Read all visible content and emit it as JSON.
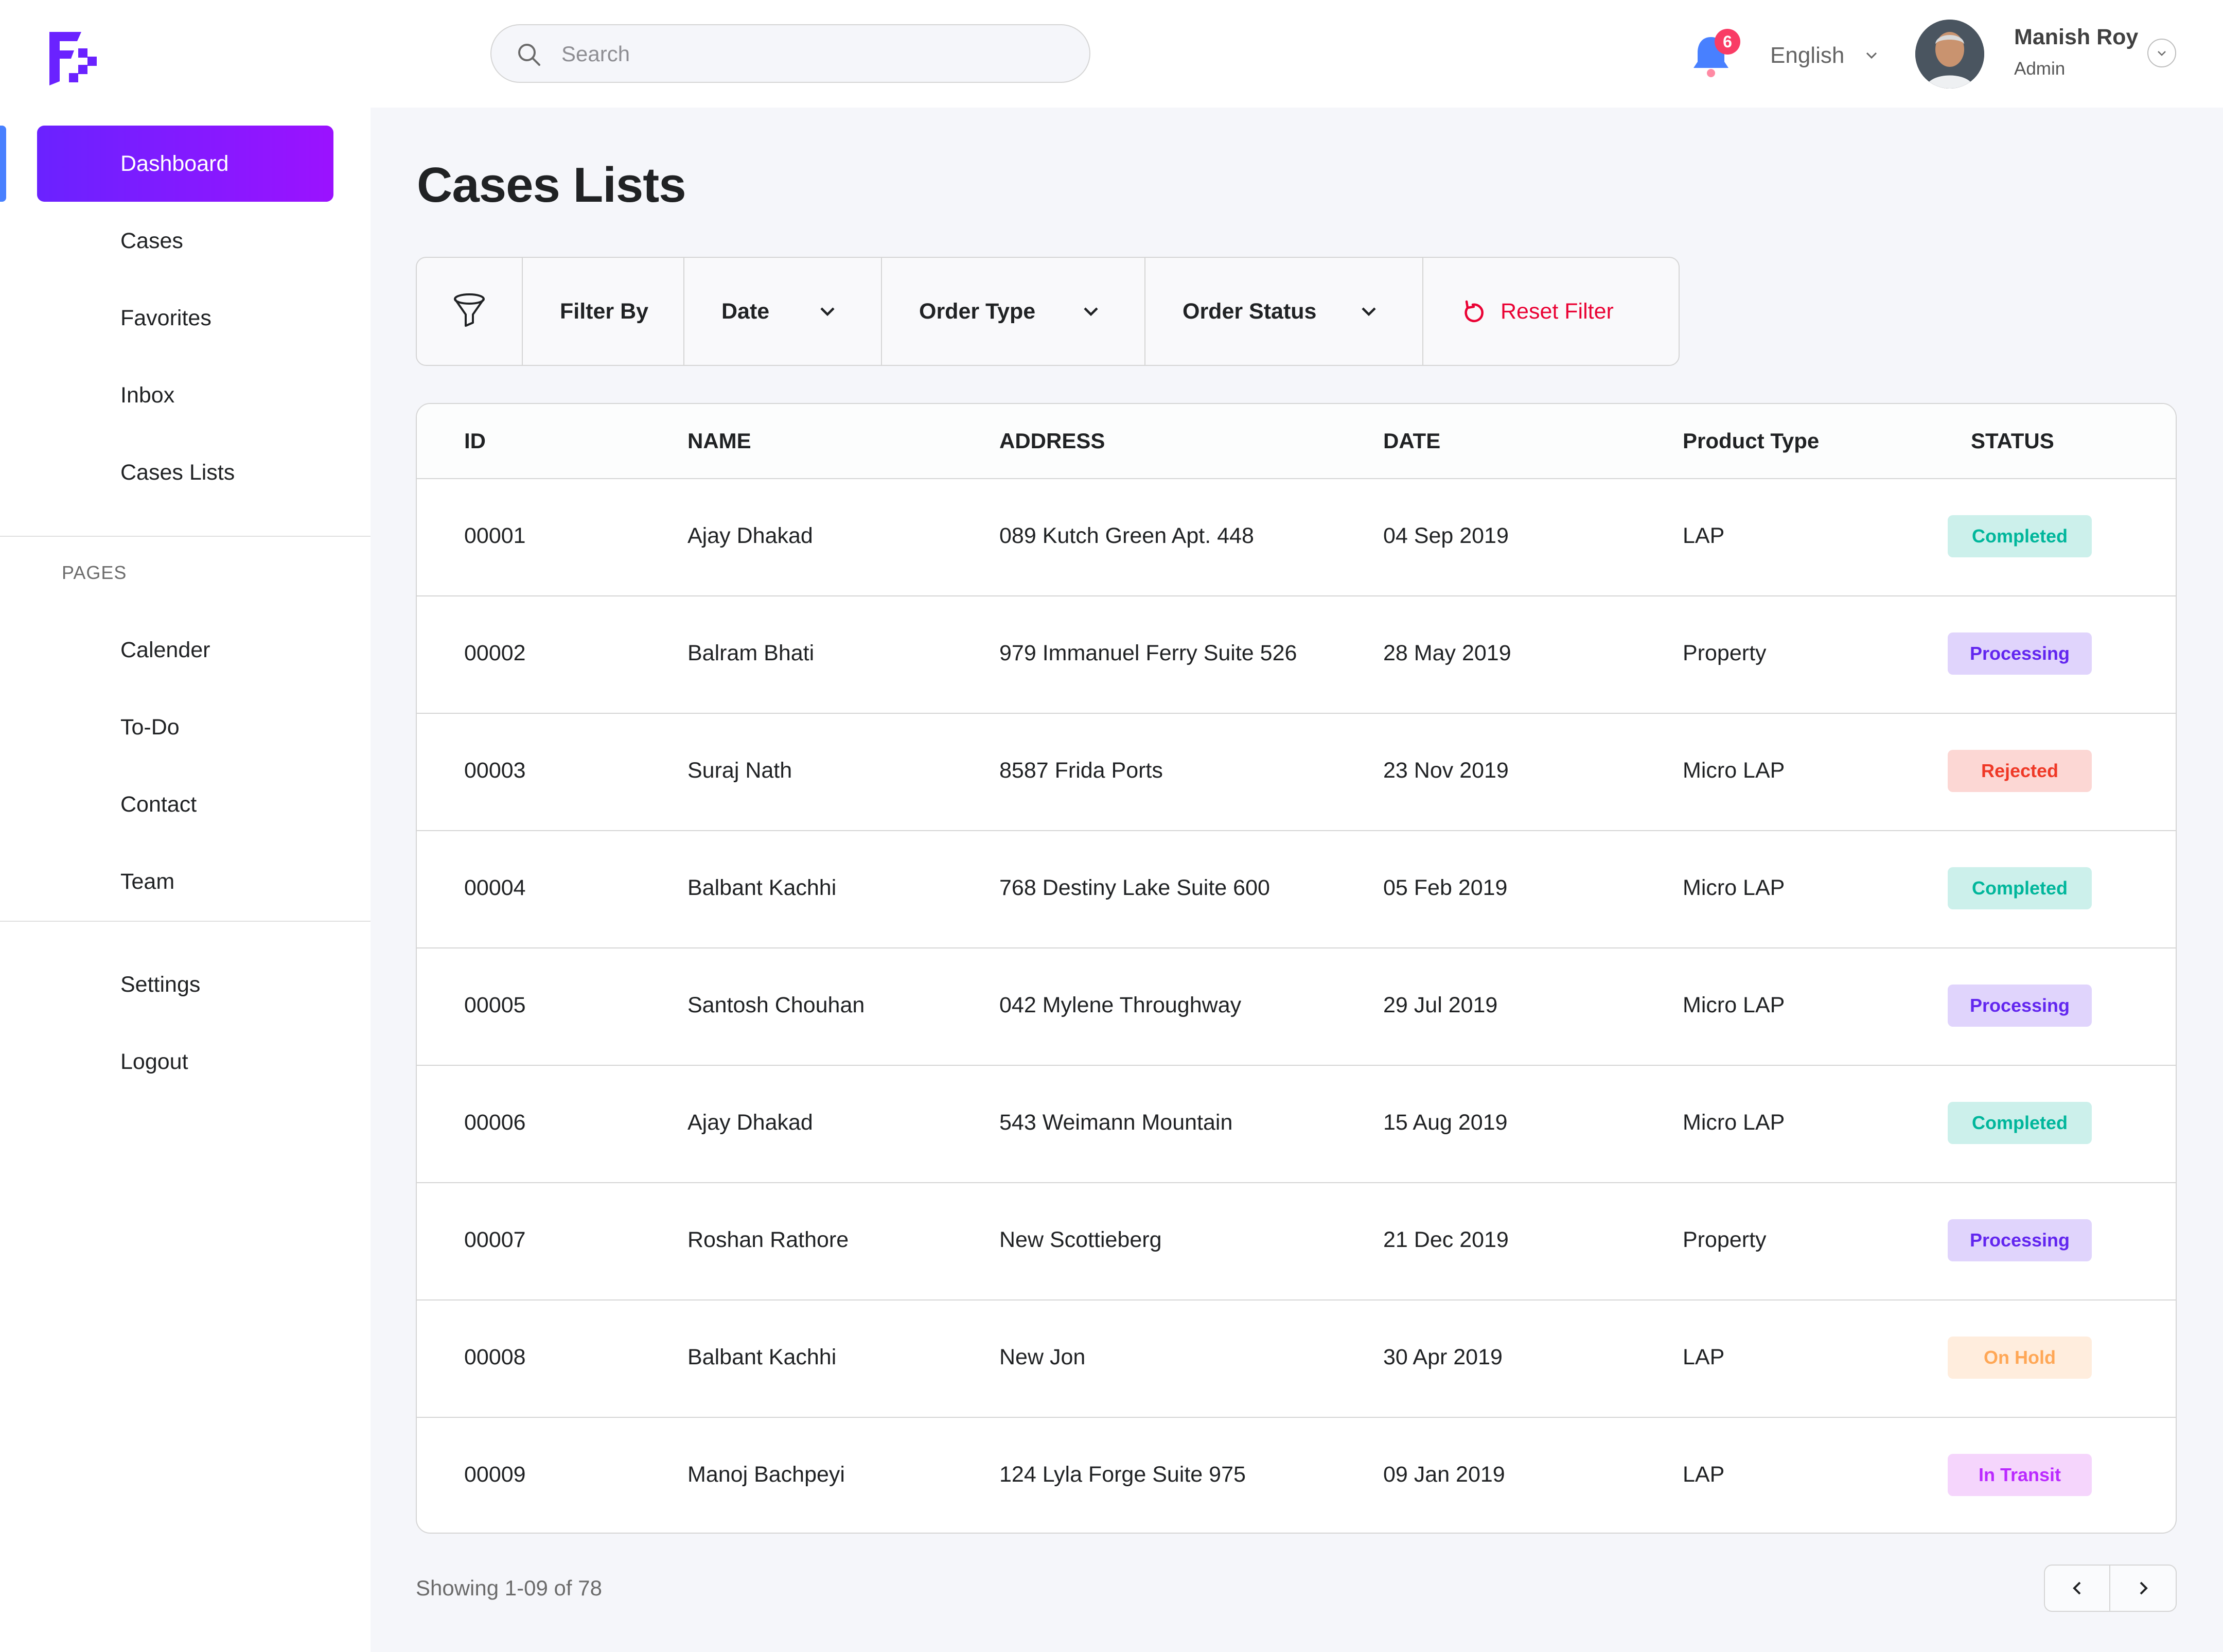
{
  "header": {
    "search_placeholder": "Search",
    "notification_count": "6",
    "language": "English",
    "user": {
      "name": "Manish Roy",
      "role": "Admin"
    }
  },
  "sidebar": {
    "items": [
      {
        "label": "Dashboard",
        "active": true
      },
      {
        "label": "Cases"
      },
      {
        "label": "Favorites"
      },
      {
        "label": "Inbox"
      },
      {
        "label": "Cases Lists"
      }
    ],
    "section_label": "PAGES",
    "pages": [
      {
        "label": "Calender"
      },
      {
        "label": "To-Do"
      },
      {
        "label": "Contact"
      },
      {
        "label": "Team"
      }
    ],
    "bottom": [
      {
        "label": "Settings"
      },
      {
        "label": "Logout"
      }
    ]
  },
  "main": {
    "title": "Cases Lists",
    "filters": {
      "filter_by": "Filter By",
      "date": "Date",
      "order_type": "Order Type",
      "order_status": "Order Status",
      "reset": "Reset Filter"
    },
    "table": {
      "columns": [
        "ID",
        "NAME",
        "ADDRESS",
        "DATE",
        "Product Type",
        "STATUS"
      ],
      "rows": [
        {
          "id": "00001",
          "name": "Ajay Dhakad",
          "address": "089 Kutch Green Apt. 448",
          "date": "04 Sep 2019",
          "type": "LAP",
          "status": "Completed"
        },
        {
          "id": "00002",
          "name": "Balram Bhati",
          "address": "979 Immanuel Ferry Suite 526",
          "date": "28 May 2019",
          "type": "Property",
          "status": "Processing"
        },
        {
          "id": "00003",
          "name": "Suraj Nath",
          "address": "8587 Frida Ports",
          "date": "23 Nov 2019",
          "type": "Micro LAP",
          "status": "Rejected"
        },
        {
          "id": "00004",
          "name": "Balbant Kachhi",
          "address": "768 Destiny Lake Suite 600",
          "date": "05 Feb 2019",
          "type": "Micro LAP",
          "status": "Completed"
        },
        {
          "id": "00005",
          "name": "Santosh Chouhan",
          "address": "042 Mylene Throughway",
          "date": "29 Jul 2019",
          "type": "Micro LAP",
          "status": "Processing"
        },
        {
          "id": "00006",
          "name": "Ajay Dhakad",
          "address": "543 Weimann Mountain",
          "date": "15 Aug 2019",
          "type": "Micro LAP",
          "status": "Completed"
        },
        {
          "id": "00007",
          "name": "Roshan Rathore",
          "address": "New Scottieberg",
          "date": "21 Dec 2019",
          "type": "Property",
          "status": "Processing"
        },
        {
          "id": "00008",
          "name": "Balbant Kachhi",
          "address": "New Jon",
          "date": "30 Apr 2019",
          "type": "LAP",
          "status": "On Hold"
        },
        {
          "id": "00009",
          "name": "Manoj Bachpeyi",
          "address": "124 Lyla Forge Suite 975",
          "date": "09 Jan 2019",
          "type": "LAP",
          "status": "In Transit"
        }
      ]
    },
    "pagination": {
      "showing": "Showing 1-09 of 78"
    }
  },
  "colors": {
    "accent": "#4880ff",
    "active_gradient_start": "#6a22ff",
    "active_gradient_end": "#9b12ff",
    "reset": "#ea0234",
    "status": {
      "Completed": {
        "bg": "#ccf0eb",
        "fg": "#00b69b"
      },
      "Processing": {
        "bg": "#e0d4fc",
        "fg": "#6226ef"
      },
      "Rejected": {
        "bg": "#fcd7d4",
        "fg": "#ef3826"
      },
      "On Hold": {
        "bg": "#ffeddd",
        "fg": "#ffa756"
      },
      "In Transit": {
        "bg": "#f5d5fc",
        "fg": "#ba29ff"
      }
    }
  },
  "icons": [
    "logo-icon",
    "search-icon",
    "bell-icon",
    "chevron-down-icon",
    "filter-icon",
    "reset-icon",
    "chevron-left-icon",
    "chevron-right-icon"
  ]
}
